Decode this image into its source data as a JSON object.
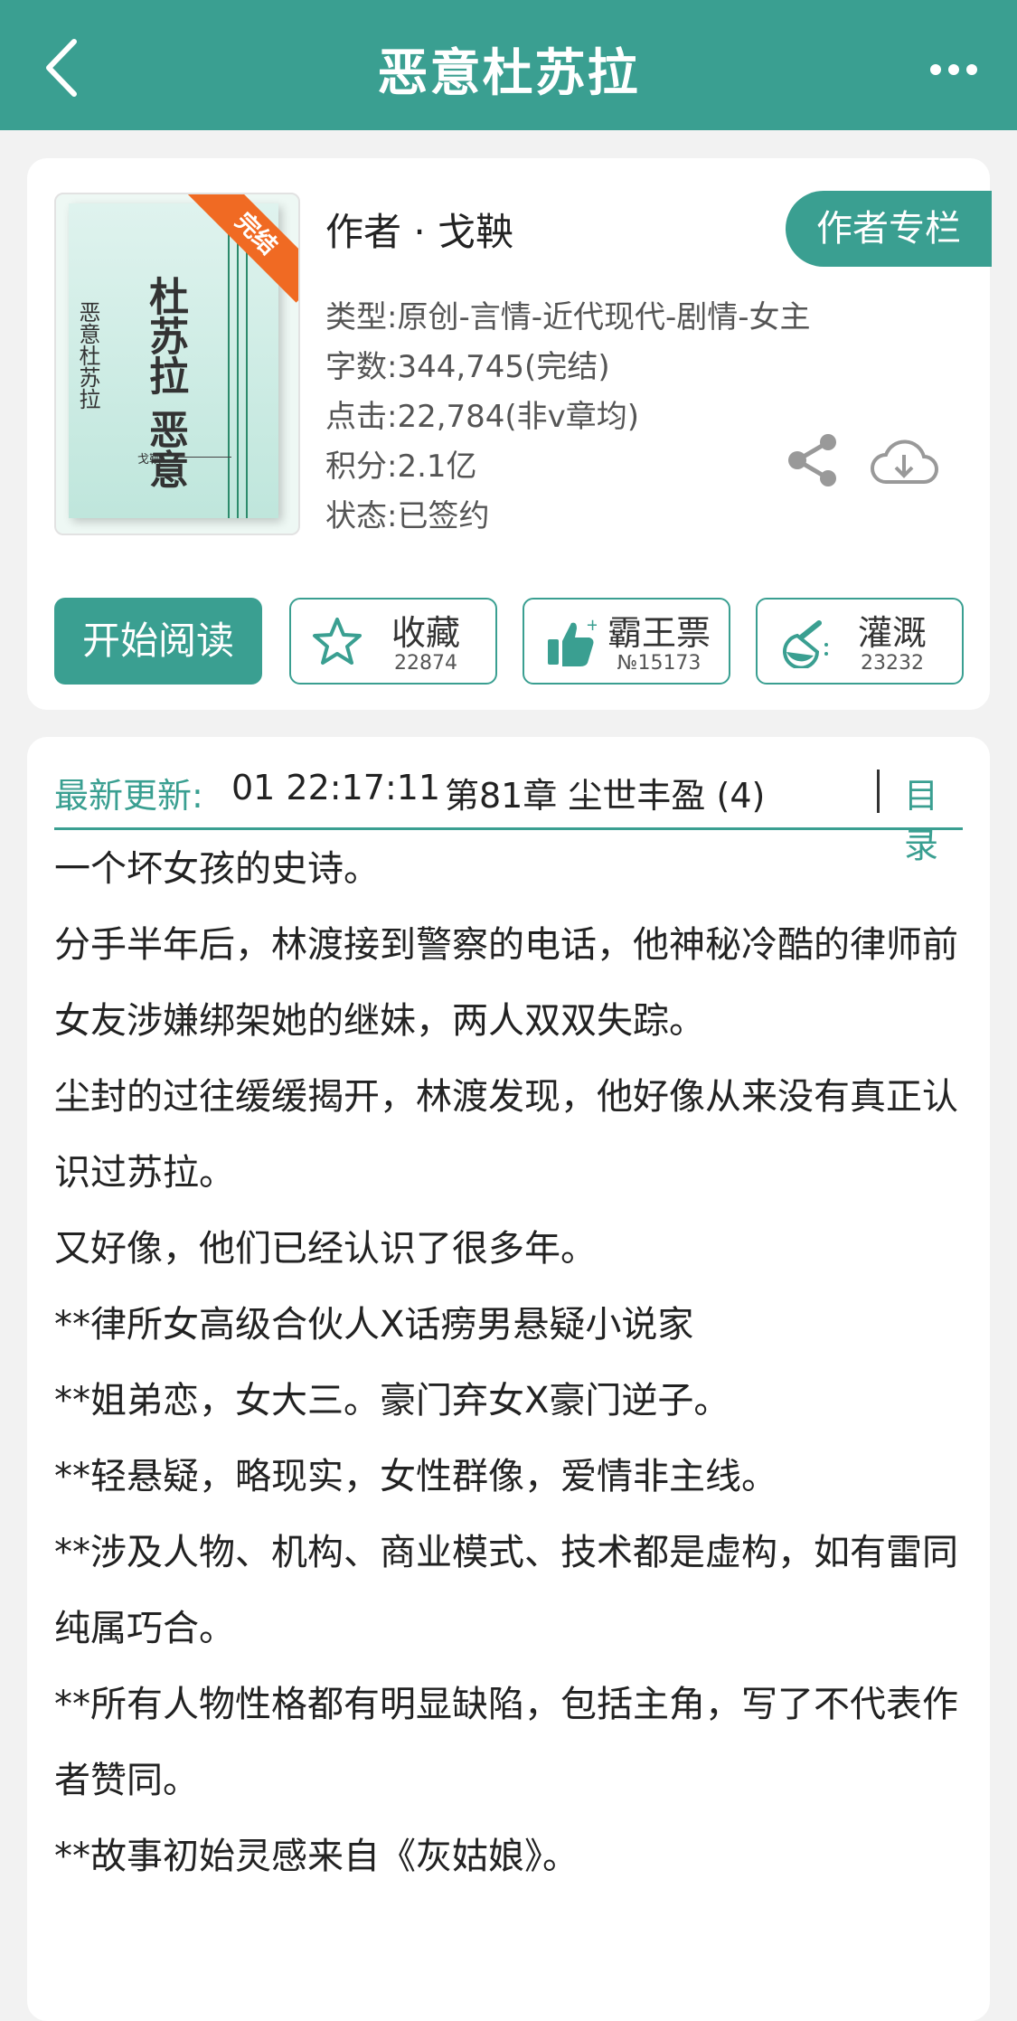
{
  "nav": {
    "title": "恶意杜苏拉",
    "back_icon": "chevron-left-icon",
    "more_icon": "more-dots-icon"
  },
  "cover": {
    "title_main": "杜苏拉 恶意",
    "title_side": "恶意杜苏拉",
    "author": "戈鞅",
    "badge": "完结"
  },
  "info": {
    "author": "作者 · 戈鞅",
    "author_column": "作者专栏",
    "genre": "类型:原创-言情-近代现代-剧情-女主",
    "words": "字数:344,745(完结)",
    "clicks": "点击:22,784(非v章均)",
    "score": "积分:2.1亿",
    "status": "状态:已签约"
  },
  "actions": {
    "read": "开始阅读",
    "favorite": {
      "label": "收藏",
      "count": "22874"
    },
    "ticket": {
      "label": "霸王票",
      "count": "№15173"
    },
    "water": {
      "label": "灌溉",
      "count": "23232"
    }
  },
  "update": {
    "label": "最新更新:",
    "time": "01 22:17:11",
    "chapter": "第81章 尘世丰盈 (4)",
    "toc": "目录"
  },
  "description": [
    "一个坏女孩的史诗。",
    "分手半年后，林渡接到警察的电话，他神秘冷酷的律师前女友涉嫌绑架她的继妹，两人双双失踪。",
    "尘封的过往缓缓揭开，林渡发现，他好像从来没有真正认识过苏拉。",
    "又好像，他们已经认识了很多年。",
    "**律所女高级合伙人X话痨男悬疑小说家",
    "**姐弟恋，女大三。豪门弃女X豪门逆子。",
    "**轻悬疑，略现实，女性群像，爱情非主线。",
    "**涉及人物、机构、商业模式、技术都是虚构，如有雷同纯属巧合。",
    "**所有人物性格都有明显缺陷，包括主角，写了不代表作者赞同。",
    "**故事初始灵感来自《灰姑娘》。"
  ],
  "colors": {
    "accent": "#3a9f91",
    "badge": "#f06a23"
  }
}
